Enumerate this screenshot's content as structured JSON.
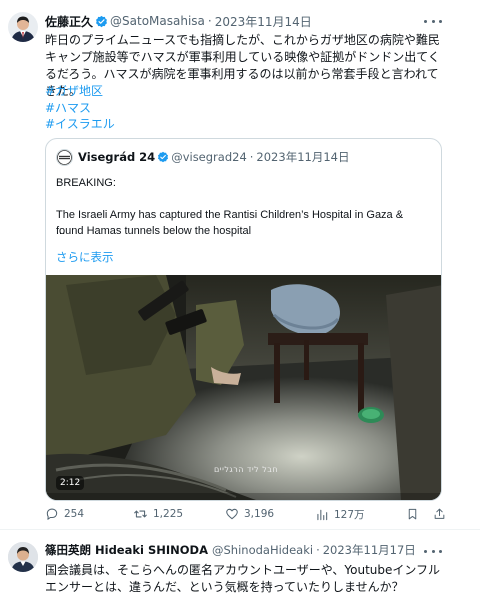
{
  "tweet": {
    "author_name": "佐藤正久",
    "handle": "@SatoMasahisa",
    "separator": "·",
    "date": "2023年11月14日",
    "text": "昨日のプライムニュースでも指摘したが、これからガザ地区の病院や難民キャンプ施設等でハマスが軍事利用している映像や証拠がドンドン出てくるだろう。ハマスが病院を軍事利用するのは以前から常套手段と言われてきた。",
    "hashtags": [
      "#ガザ地区",
      "#ハマス",
      "#イスラエル"
    ]
  },
  "quote": {
    "author_name": "Visegrád 24",
    "handle": "@visegrad24",
    "separator": "·",
    "date": "2023年11月14日",
    "line1": "BREAKING:",
    "line2": "The Israeli Army has captured the Rantisi Children’s Hospital in Gaza & found Hamas tunnels below the hospital",
    "line3": "...",
    "show_more": "さらに表示",
    "video_caption": "חבל ליד הרגליים",
    "video_duration": "2:12"
  },
  "actions": {
    "replies": "254",
    "retweets": "1,225",
    "likes": "3,196",
    "views": "127万"
  },
  "tweet2": {
    "author_name": "篠田英朗 Hideaki SHINODA",
    "handle": "@ShinodaHideaki",
    "separator": "·",
    "date": "2023年11月17日",
    "text": "国会議員は、そこらへんの匿名アカウントユーザーや、Youtubeインフルエンサーとは、違うんだ、という気概を持っていたりしませんか？"
  },
  "colors": {
    "accent": "#1d9bf0",
    "muted": "#536471",
    "border": "#cfd9de",
    "text": "#0f1419"
  }
}
